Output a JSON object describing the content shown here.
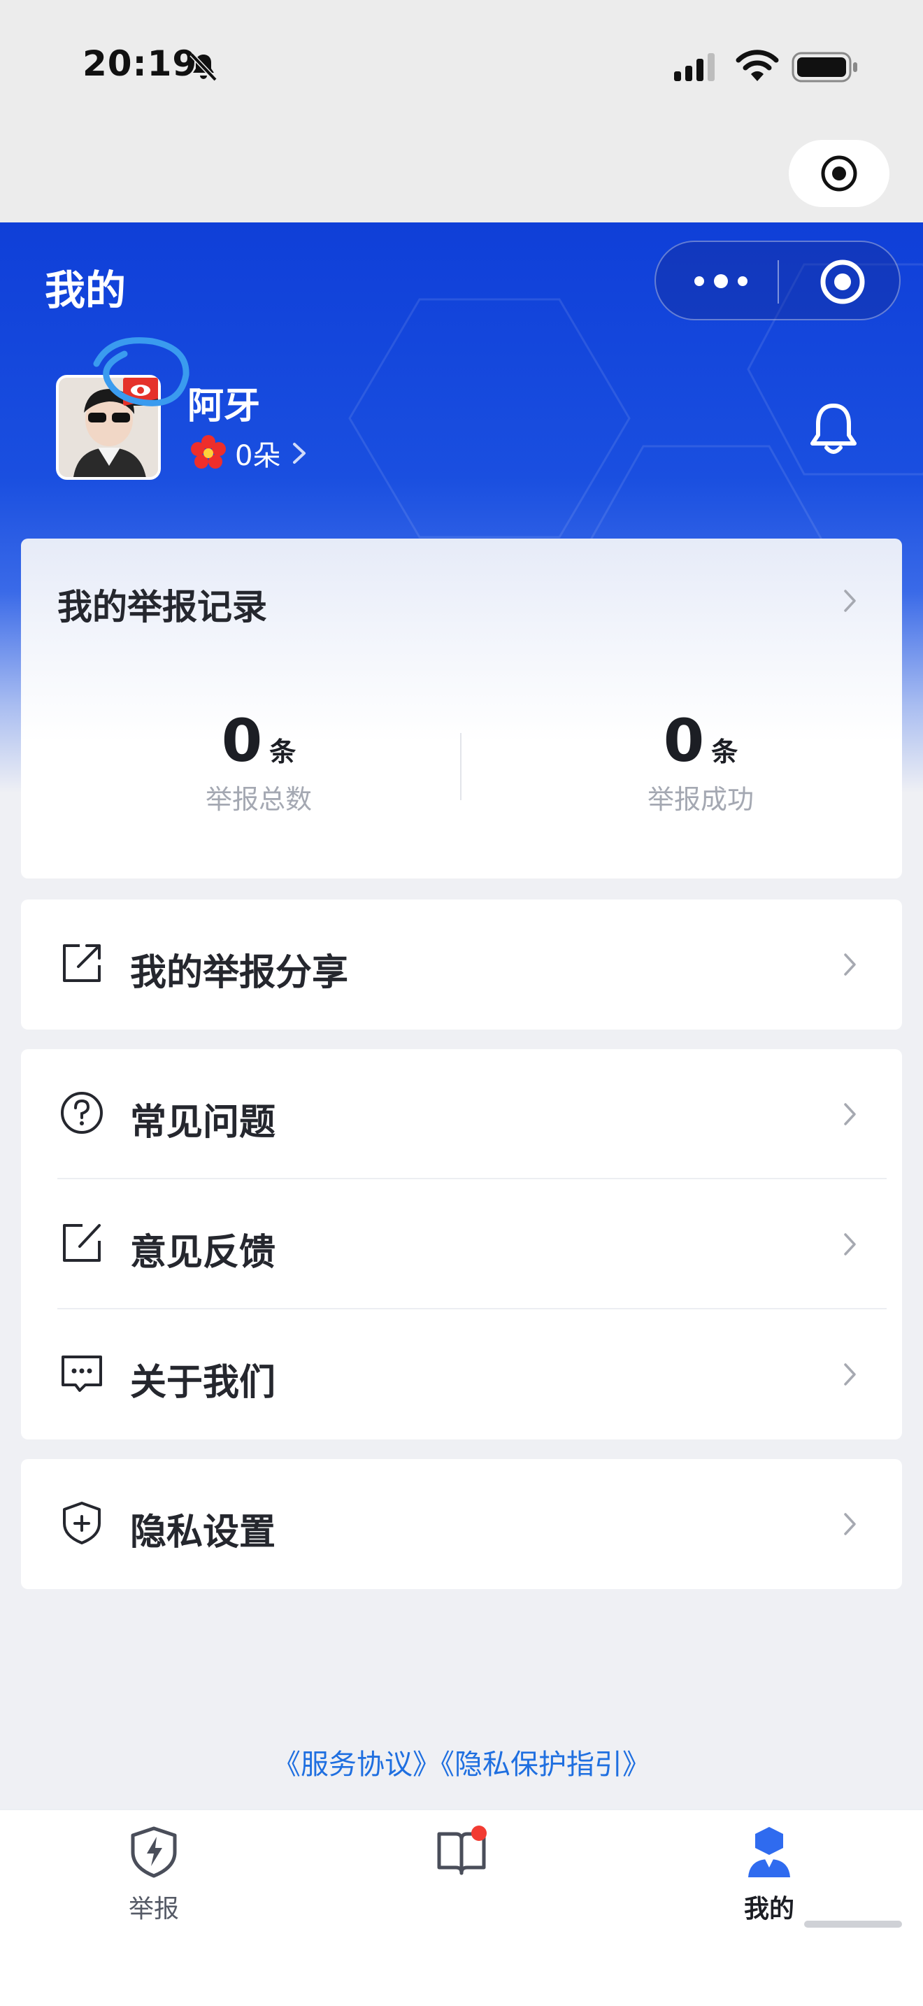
{
  "status_bar": {
    "time": "20:19"
  },
  "header": {
    "title": "我的"
  },
  "profile": {
    "name": "阿牙",
    "flowers": "0朵"
  },
  "records": {
    "title": "我的举报记录",
    "stats": [
      {
        "value": "0",
        "unit": "条",
        "label": "举报总数"
      },
      {
        "value": "0",
        "unit": "条",
        "label": "举报成功"
      }
    ]
  },
  "menu": {
    "share": "我的举报分享",
    "faq": "常见问题",
    "feedback": "意见反馈",
    "about": "关于我们",
    "privacy": "隐私设置"
  },
  "footer_links": "《服务协议》《隐私保护指引》",
  "tabs": [
    {
      "label": "举报",
      "icon": "shield-lightning-icon"
    },
    {
      "label": "",
      "icon": "book-icon",
      "has_badge": true
    },
    {
      "label": "我的",
      "icon": "user-icon",
      "active": true
    }
  ],
  "colors": {
    "brand_blue": "#1a4fe0",
    "link_blue": "#1f6fe0",
    "badge_red": "#f23b32"
  }
}
